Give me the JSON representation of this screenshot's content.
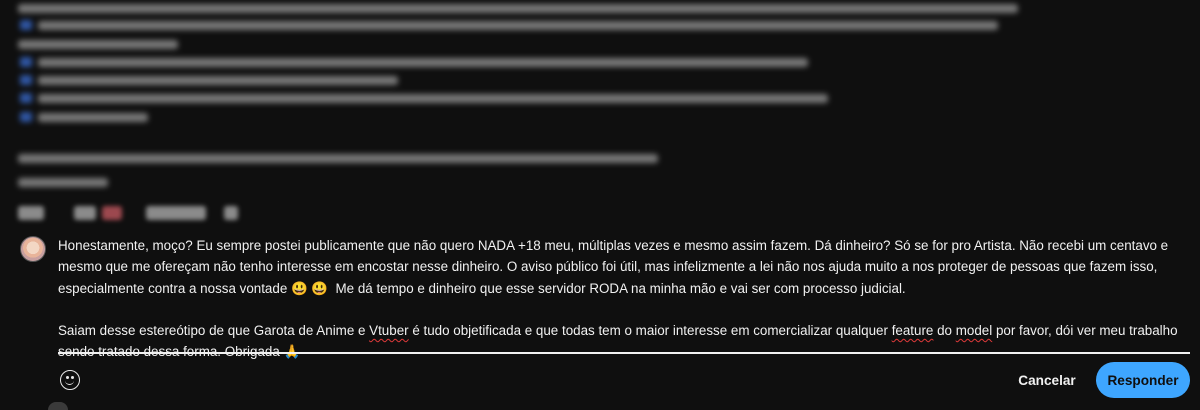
{
  "reply": {
    "paragraph1_a": "Honestamente, moço? Eu sempre postei publicamente que não quero NADA +18 meu, múltiplas vezes e mesmo assim fazem. Dá dinheiro? Só se for pro Artista. Não recebi um centavo e mesmo que me ofereçam não tenho interesse em encostar nesse dinheiro. O aviso público foi útil, mas infelizmente a lei não nos ajuda muito a nos proteger de pessoas que fazem isso, especialmente contra a nossa vontade ",
    "emojis": "😃 😃",
    "paragraph1_b": "  Me dá tempo e dinheiro que esse servidor RODA na minha mão e vai ser com processo judicial.",
    "paragraph2_a": "Saiam desse estereótipo de que Garota de Anime e ",
    "word_vtuber": "Vtuber",
    "paragraph2_b": " é tudo objetificada e que todas tem o maior interesse em comercializar qualquer ",
    "word_feature": "feature",
    "paragraph2_c": " do ",
    "word_model": "model",
    "paragraph2_d": " por favor, dói ver meu trabalho sendo tratado dessa forma. Obrigada 🙏"
  },
  "actions": {
    "cancel_label": "Cancelar",
    "reply_label": "Responder"
  },
  "icons": {
    "emoji": "smile-icon"
  },
  "colors": {
    "background": "#0f0f0f",
    "accent": "#3ea6ff",
    "text": "#f1f1f1"
  }
}
